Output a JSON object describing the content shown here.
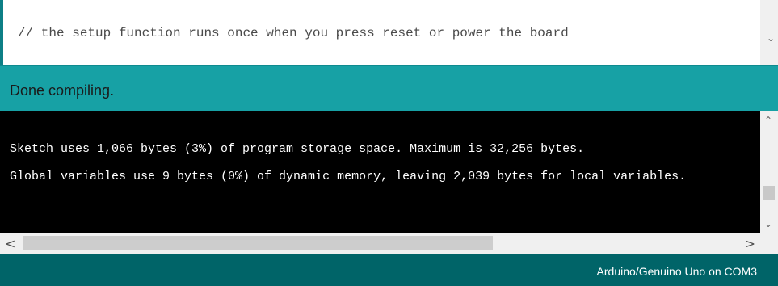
{
  "editor": {
    "code_line": "// the setup function runs once when you press reset or power the board"
  },
  "status": {
    "message": "Done compiling."
  },
  "console": {
    "lines": [
      "Sketch uses 1,066 bytes (3%) of program storage space. Maximum is 32,256 bytes.",
      "Global variables use 9 bytes (0%) of dynamic memory, leaving 2,039 bytes for local variables."
    ]
  },
  "footer": {
    "board_port": "Arduino/Genuino Uno on COM3"
  },
  "icons": {
    "editor_scroll_down": "chevron-down-icon",
    "console_scroll_up": "chevron-up-icon",
    "console_scroll_down": "chevron-down-icon",
    "hscroll_left": "chevron-left-icon",
    "hscroll_right": "chevron-right-icon"
  },
  "colors": {
    "status_bar": "#17a1a5",
    "footer": "#006468",
    "console_bg": "#000000",
    "console_text": "#ffffff"
  }
}
